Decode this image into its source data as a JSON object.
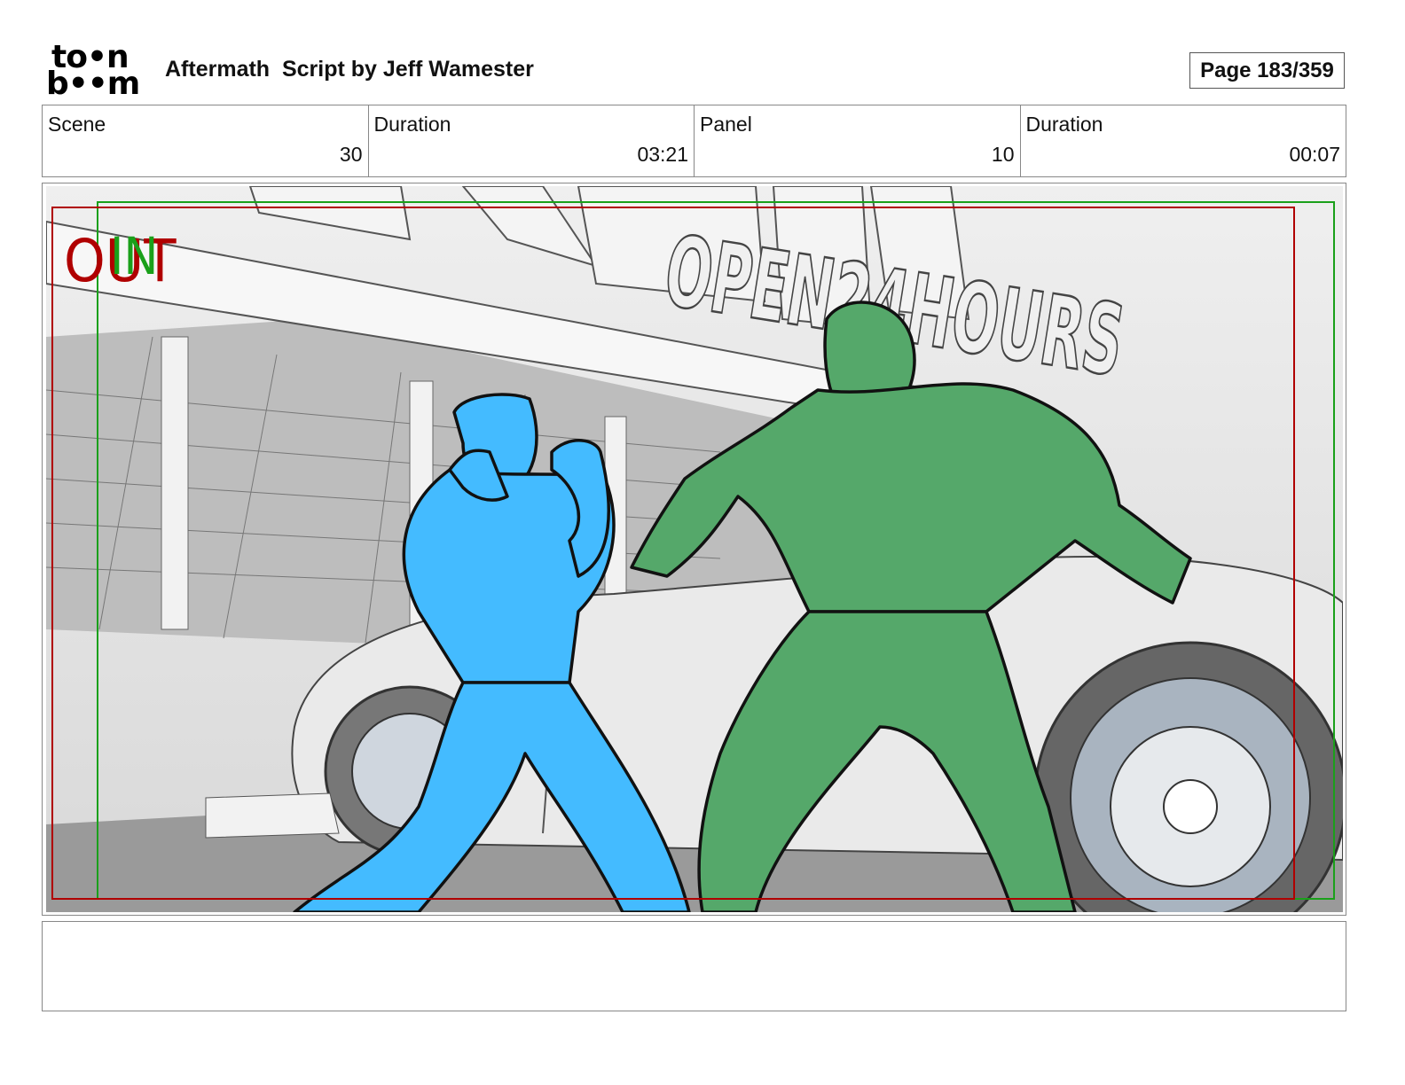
{
  "header": {
    "logo": {
      "line1": "to•n",
      "line2": "b••m",
      "icon": "toon-boom-logo"
    },
    "title": "Aftermath  Script by Jeff Wamester",
    "page": "Page 183/359"
  },
  "info": [
    {
      "label": "Scene",
      "value": "30"
    },
    {
      "label": "Duration",
      "value": "03:21"
    },
    {
      "label": "Panel",
      "value": "10"
    },
    {
      "label": "Duration",
      "value": "00:07"
    }
  ],
  "panel": {
    "out_label": "OUT",
    "in_label": "IN",
    "sign_text": "OPEN24HOURS",
    "colors": {
      "out": "#b00000",
      "in": "#1aa01a",
      "hero": "#44bbff",
      "villain": "#55a86a"
    }
  },
  "notes": ""
}
